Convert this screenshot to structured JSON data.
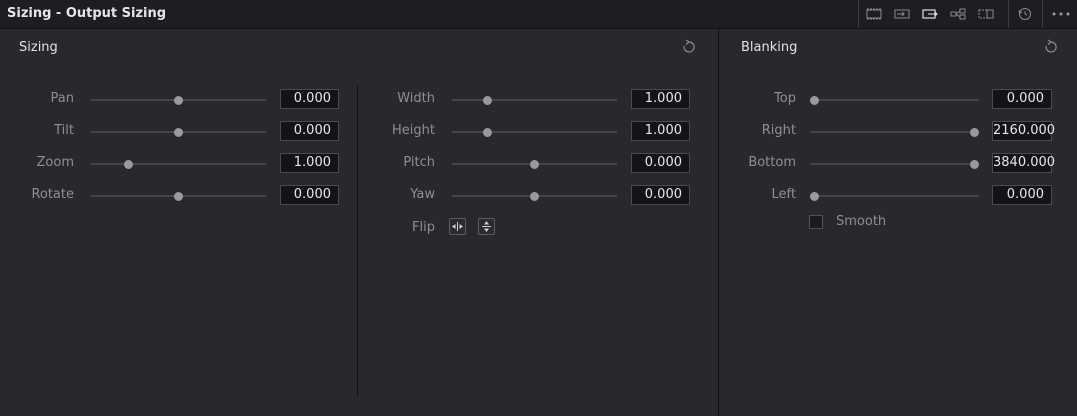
{
  "header": {
    "title": "Sizing - Output Sizing",
    "mode_icons": [
      "edit-sizing-icon",
      "input-sizing-icon",
      "output-sizing-icon",
      "node-sizing-icon",
      "reference-sizing-icon"
    ],
    "history_icon": "reset-all-icon",
    "options_icon": "more-options-icon"
  },
  "sizing": {
    "title": "Sizing",
    "left": [
      {
        "label": "Pan",
        "value": "0.000",
        "pos": 0.5
      },
      {
        "label": "Tilt",
        "value": "0.000",
        "pos": 0.5
      },
      {
        "label": "Zoom",
        "value": "1.000",
        "pos": 0.2
      },
      {
        "label": "Rotate",
        "value": "0.000",
        "pos": 0.5
      }
    ],
    "right": [
      {
        "label": "Width",
        "value": "1.000",
        "pos": 0.2
      },
      {
        "label": "Height",
        "value": "1.000",
        "pos": 0.2
      },
      {
        "label": "Pitch",
        "value": "0.000",
        "pos": 0.5
      },
      {
        "label": "Yaw",
        "value": "0.000",
        "pos": 0.5
      }
    ],
    "flip_label": "Flip"
  },
  "blanking": {
    "title": "Blanking",
    "rows": [
      {
        "label": "Top",
        "value": "0.000",
        "pos": 0.0
      },
      {
        "label": "Right",
        "value": "2160.000",
        "pos": 1.0
      },
      {
        "label": "Bottom",
        "value": "3840.000",
        "pos": 1.0
      },
      {
        "label": "Left",
        "value": "0.000",
        "pos": 0.0
      }
    ],
    "smooth_label": "Smooth",
    "smooth_checked": false
  }
}
